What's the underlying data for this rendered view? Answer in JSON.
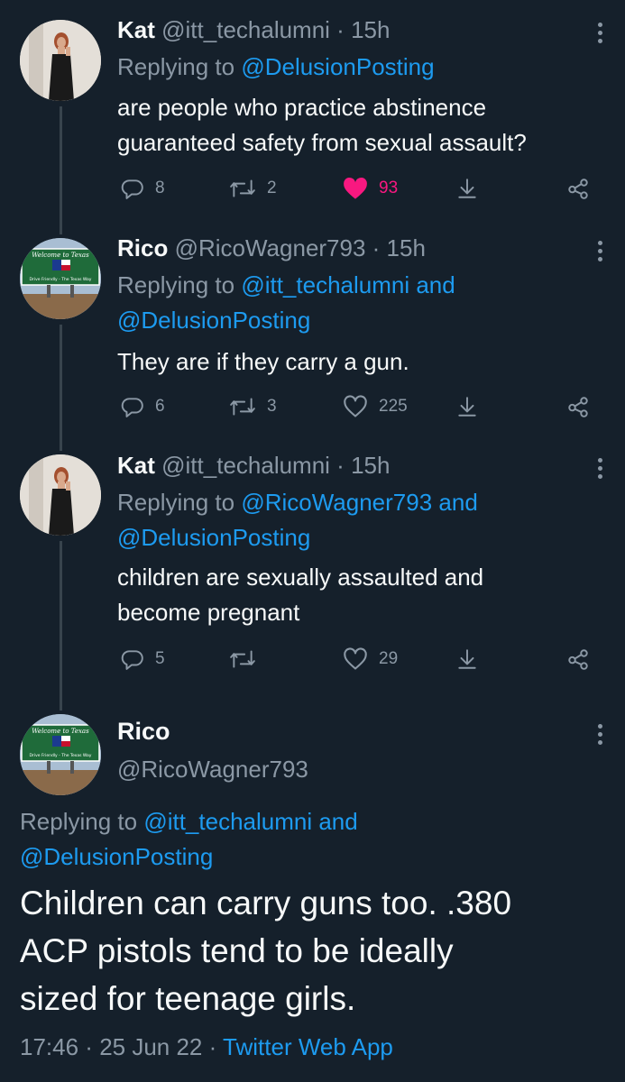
{
  "tweets": [
    {
      "name": "Kat",
      "handle": "@itt_techalumni",
      "sep": " · ",
      "time": "15h",
      "replying_prefix": "Replying to ",
      "replying_line1": "@DelusionPosting",
      "replying_line2": "",
      "text_lines": [
        "are people who practice abstinence",
        "guaranteed safety from sexual assault?"
      ],
      "replies": "8",
      "retweets": "2",
      "likes": "93",
      "liked": true
    },
    {
      "name": "Rico",
      "handle": "@RicoWagner793",
      "sep": " · ",
      "time": "15h",
      "replying_prefix": "Replying to ",
      "replying_line1": "@itt_techalumni and",
      "replying_line2": "@DelusionPosting",
      "text_lines": [
        "They are if they carry a gun."
      ],
      "replies": "6",
      "retweets": "3",
      "likes": "225",
      "liked": false
    },
    {
      "name": "Kat",
      "handle": "@itt_techalumni",
      "sep": " · ",
      "time": "15h",
      "replying_prefix": "Replying to ",
      "replying_line1": "@RicoWagner793 and",
      "replying_line2": "@DelusionPosting",
      "text_lines": [
        "children are sexually assaulted and",
        "become pregnant"
      ],
      "replies": "5",
      "retweets": "",
      "likes": "29",
      "liked": false
    }
  ],
  "avatar_rico": {
    "sign_top": "Welcome to Texas",
    "sign_bottom": "Drive Friendly - The Texas Way"
  },
  "main_tweet": {
    "name": "Rico",
    "handle": "@RicoWagner793",
    "replying_prefix": "Replying to ",
    "replying_line1": "@itt_techalumni and",
    "replying_line2": "@DelusionPosting",
    "text_lines": [
      "Children can carry guns too. .380",
      "ACP pistols tend to be ideally",
      "sized for teenage girls."
    ],
    "time": "17:46",
    "date": "25 Jun 22",
    "sep": " · ",
    "source": "Twitter Web App"
  },
  "colors": {
    "background": "#15202b",
    "text": "#f7f9f9",
    "secondary": "#8b98a5",
    "link": "#1d9bf0",
    "like": "#f91880"
  },
  "icons": [
    "reply-icon",
    "retweet-icon",
    "like-icon",
    "share-icon",
    "more-icon"
  ]
}
